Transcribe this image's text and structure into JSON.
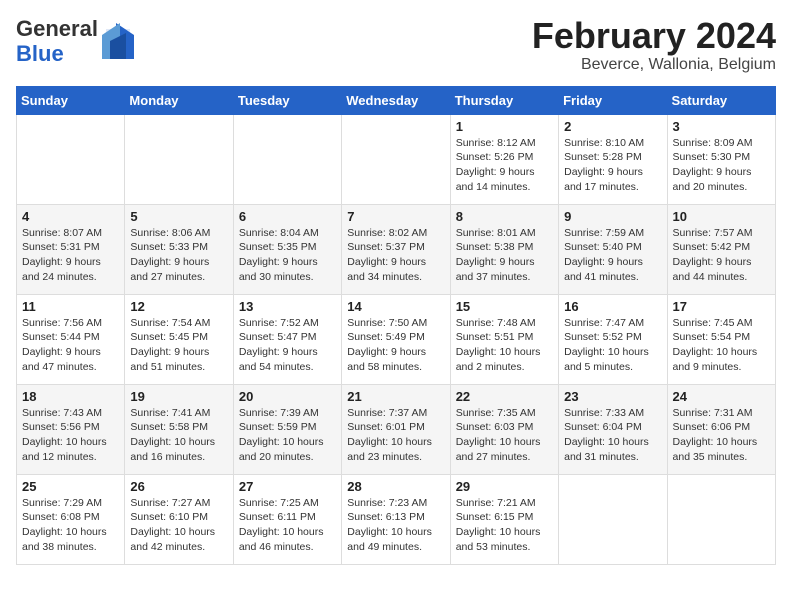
{
  "logo": {
    "general": "General",
    "blue": "Blue"
  },
  "title": "February 2024",
  "subtitle": "Beverce, Wallonia, Belgium",
  "days_of_week": [
    "Sunday",
    "Monday",
    "Tuesday",
    "Wednesday",
    "Thursday",
    "Friday",
    "Saturday"
  ],
  "weeks": [
    [
      {
        "day": "",
        "content": ""
      },
      {
        "day": "",
        "content": ""
      },
      {
        "day": "",
        "content": ""
      },
      {
        "day": "",
        "content": ""
      },
      {
        "day": "1",
        "content": "Sunrise: 8:12 AM\nSunset: 5:26 PM\nDaylight: 9 hours\nand 14 minutes."
      },
      {
        "day": "2",
        "content": "Sunrise: 8:10 AM\nSunset: 5:28 PM\nDaylight: 9 hours\nand 17 minutes."
      },
      {
        "day": "3",
        "content": "Sunrise: 8:09 AM\nSunset: 5:30 PM\nDaylight: 9 hours\nand 20 minutes."
      }
    ],
    [
      {
        "day": "4",
        "content": "Sunrise: 8:07 AM\nSunset: 5:31 PM\nDaylight: 9 hours\nand 24 minutes."
      },
      {
        "day": "5",
        "content": "Sunrise: 8:06 AM\nSunset: 5:33 PM\nDaylight: 9 hours\nand 27 minutes."
      },
      {
        "day": "6",
        "content": "Sunrise: 8:04 AM\nSunset: 5:35 PM\nDaylight: 9 hours\nand 30 minutes."
      },
      {
        "day": "7",
        "content": "Sunrise: 8:02 AM\nSunset: 5:37 PM\nDaylight: 9 hours\nand 34 minutes."
      },
      {
        "day": "8",
        "content": "Sunrise: 8:01 AM\nSunset: 5:38 PM\nDaylight: 9 hours\nand 37 minutes."
      },
      {
        "day": "9",
        "content": "Sunrise: 7:59 AM\nSunset: 5:40 PM\nDaylight: 9 hours\nand 41 minutes."
      },
      {
        "day": "10",
        "content": "Sunrise: 7:57 AM\nSunset: 5:42 PM\nDaylight: 9 hours\nand 44 minutes."
      }
    ],
    [
      {
        "day": "11",
        "content": "Sunrise: 7:56 AM\nSunset: 5:44 PM\nDaylight: 9 hours\nand 47 minutes."
      },
      {
        "day": "12",
        "content": "Sunrise: 7:54 AM\nSunset: 5:45 PM\nDaylight: 9 hours\nand 51 minutes."
      },
      {
        "day": "13",
        "content": "Sunrise: 7:52 AM\nSunset: 5:47 PM\nDaylight: 9 hours\nand 54 minutes."
      },
      {
        "day": "14",
        "content": "Sunrise: 7:50 AM\nSunset: 5:49 PM\nDaylight: 9 hours\nand 58 minutes."
      },
      {
        "day": "15",
        "content": "Sunrise: 7:48 AM\nSunset: 5:51 PM\nDaylight: 10 hours\nand 2 minutes."
      },
      {
        "day": "16",
        "content": "Sunrise: 7:47 AM\nSunset: 5:52 PM\nDaylight: 10 hours\nand 5 minutes."
      },
      {
        "day": "17",
        "content": "Sunrise: 7:45 AM\nSunset: 5:54 PM\nDaylight: 10 hours\nand 9 minutes."
      }
    ],
    [
      {
        "day": "18",
        "content": "Sunrise: 7:43 AM\nSunset: 5:56 PM\nDaylight: 10 hours\nand 12 minutes."
      },
      {
        "day": "19",
        "content": "Sunrise: 7:41 AM\nSunset: 5:58 PM\nDaylight: 10 hours\nand 16 minutes."
      },
      {
        "day": "20",
        "content": "Sunrise: 7:39 AM\nSunset: 5:59 PM\nDaylight: 10 hours\nand 20 minutes."
      },
      {
        "day": "21",
        "content": "Sunrise: 7:37 AM\nSunset: 6:01 PM\nDaylight: 10 hours\nand 23 minutes."
      },
      {
        "day": "22",
        "content": "Sunrise: 7:35 AM\nSunset: 6:03 PM\nDaylight: 10 hours\nand 27 minutes."
      },
      {
        "day": "23",
        "content": "Sunrise: 7:33 AM\nSunset: 6:04 PM\nDaylight: 10 hours\nand 31 minutes."
      },
      {
        "day": "24",
        "content": "Sunrise: 7:31 AM\nSunset: 6:06 PM\nDaylight: 10 hours\nand 35 minutes."
      }
    ],
    [
      {
        "day": "25",
        "content": "Sunrise: 7:29 AM\nSunset: 6:08 PM\nDaylight: 10 hours\nand 38 minutes."
      },
      {
        "day": "26",
        "content": "Sunrise: 7:27 AM\nSunset: 6:10 PM\nDaylight: 10 hours\nand 42 minutes."
      },
      {
        "day": "27",
        "content": "Sunrise: 7:25 AM\nSunset: 6:11 PM\nDaylight: 10 hours\nand 46 minutes."
      },
      {
        "day": "28",
        "content": "Sunrise: 7:23 AM\nSunset: 6:13 PM\nDaylight: 10 hours\nand 49 minutes."
      },
      {
        "day": "29",
        "content": "Sunrise: 7:21 AM\nSunset: 6:15 PM\nDaylight: 10 hours\nand 53 minutes."
      },
      {
        "day": "",
        "content": ""
      },
      {
        "day": "",
        "content": ""
      }
    ]
  ]
}
